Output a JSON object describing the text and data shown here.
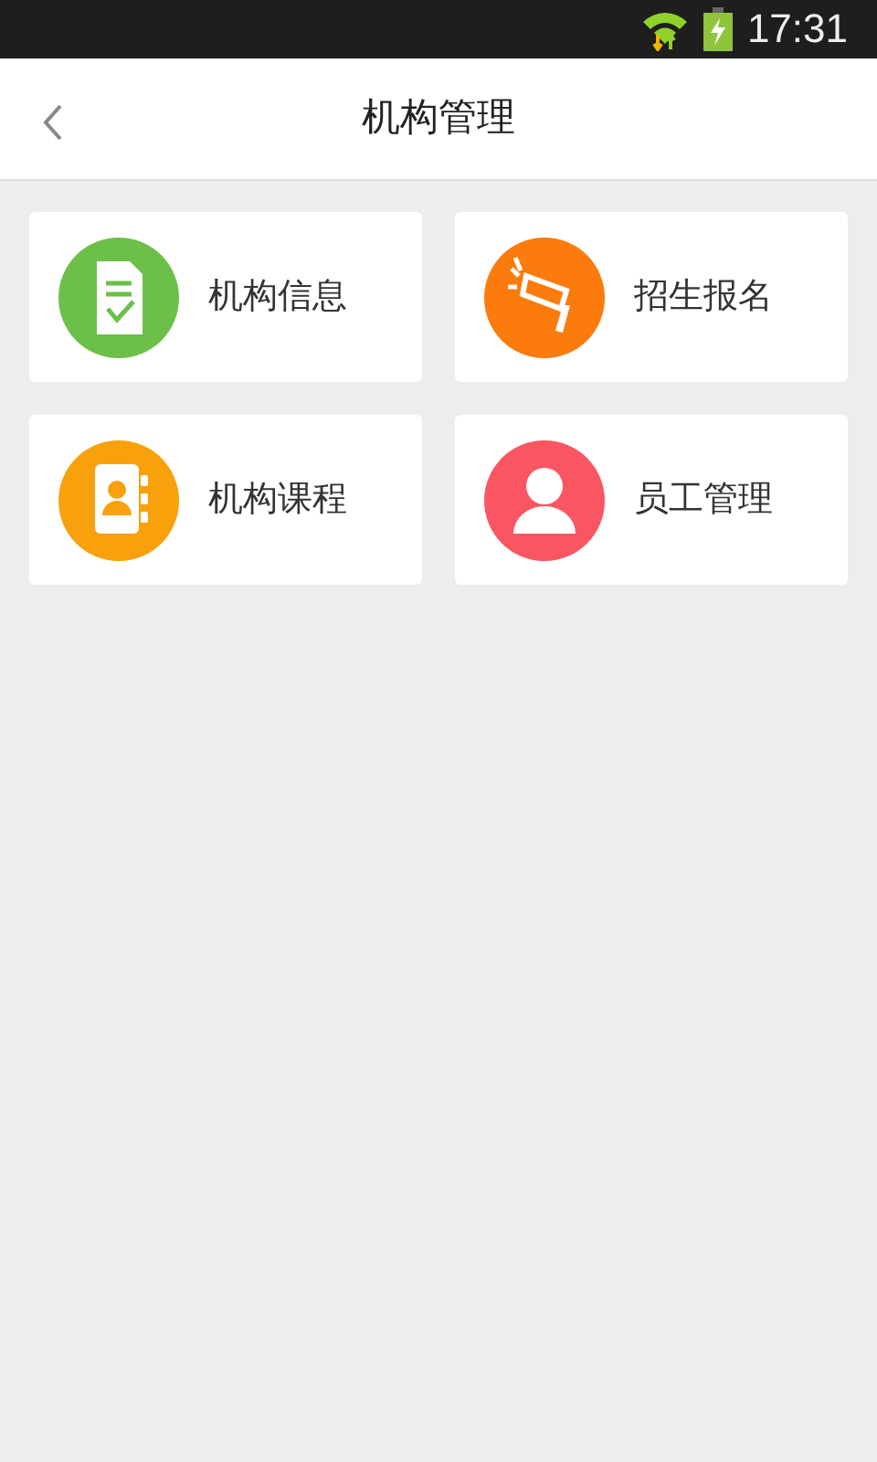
{
  "status_bar": {
    "time": "17:31"
  },
  "header": {
    "title": "机构管理"
  },
  "tiles": [
    {
      "label": "机构信息",
      "kind": "document",
      "color": "#6cc04a"
    },
    {
      "label": "招生报名",
      "kind": "megaphone",
      "color": "#fb7b0c"
    },
    {
      "label": "机构课程",
      "kind": "contacts",
      "color": "#f8a10c"
    },
    {
      "label": "员工管理",
      "kind": "person",
      "color": "#fa5563"
    }
  ]
}
